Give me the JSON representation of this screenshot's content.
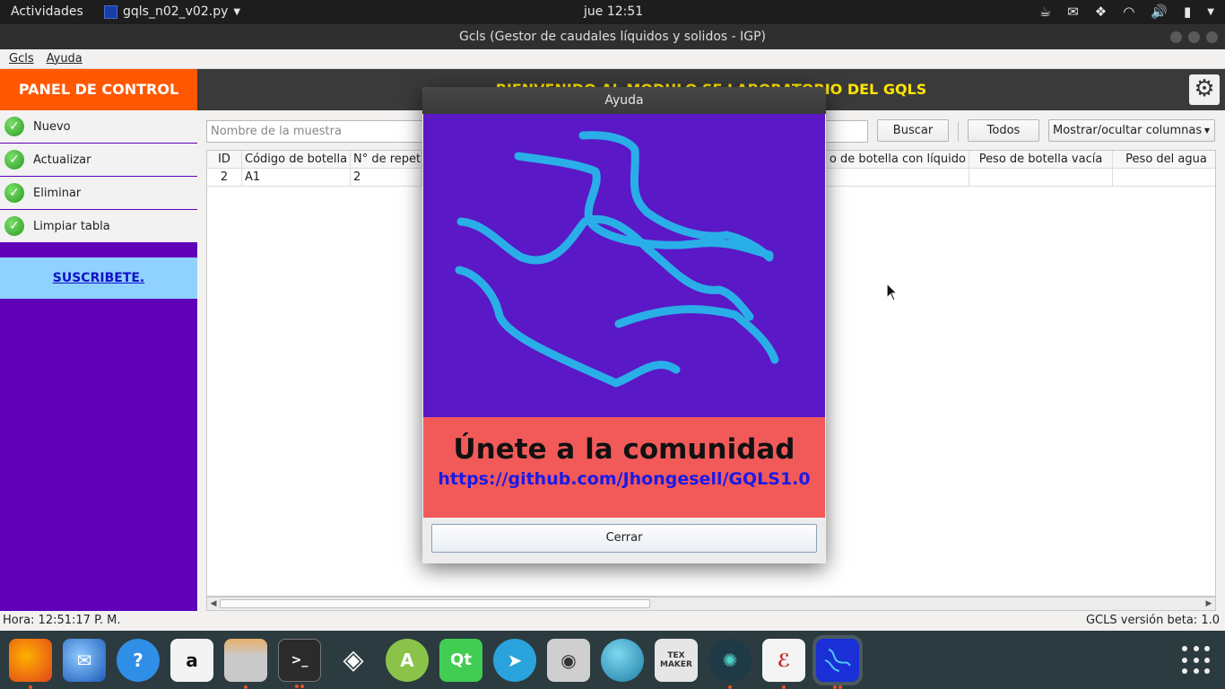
{
  "topbar": {
    "activities": "Actividades",
    "app_name": "gqls_n02_v02.py",
    "clock": "jue 12:51"
  },
  "window": {
    "title": "Gcls (Gestor de caudales líquidos y solidos - IGP)"
  },
  "menubar": {
    "items": [
      {
        "label": "Gcls"
      },
      {
        "label": "Ayuda"
      }
    ]
  },
  "sidebar": {
    "header": "PANEL DE CONTROL",
    "items": [
      {
        "label": "Nuevo"
      },
      {
        "label": "Actualizar"
      },
      {
        "label": "Eliminar"
      },
      {
        "label": "Limpiar tabla"
      }
    ],
    "subscribe": "SUSCRIBETE."
  },
  "main": {
    "banner": "BIENVENIDO AL MODULO SE LABORATORIO DEL GQLS",
    "search_placeholder": "Nombre de la muestra",
    "search_button": "Buscar",
    "all_button": "Todos",
    "columns_button": "Mostrar/ocultar columnas"
  },
  "table": {
    "headers": [
      "ID",
      "Código de botella",
      "N° de repet",
      "",
      "o de botella con líquido",
      "Peso de botella vacía",
      "Peso del agua"
    ],
    "rows": [
      [
        "2",
        "A1",
        "2",
        "",
        "",
        "",
        ""
      ]
    ]
  },
  "status": {
    "left": "Hora: 12:51:17 P. M.",
    "right": "GCLS versión beta: 1.0"
  },
  "dialog": {
    "title": "Ayuda",
    "headline": "Únete a la comunidad",
    "url": "https://github.com/Jhongesell/GQLS1.0",
    "close_button": "Cerrar"
  },
  "dock": {
    "apps": [
      {
        "icon": "firefox-icon"
      },
      {
        "icon": "thunderbird-icon"
      },
      {
        "icon": "help-icon"
      },
      {
        "icon": "amazon-icon"
      },
      {
        "icon": "files-icon"
      },
      {
        "icon": "terminal-icon"
      },
      {
        "icon": "unity-icon"
      },
      {
        "icon": "android-studio-icon"
      },
      {
        "icon": "qt-creator-icon"
      },
      {
        "icon": "telegram-icon"
      },
      {
        "icon": "camera-icon"
      },
      {
        "icon": "globe-icon"
      },
      {
        "icon": "texmaker-icon"
      },
      {
        "icon": "gitkraken-icon"
      },
      {
        "icon": "pdf-viewer-icon"
      },
      {
        "icon": "gcls-app-icon"
      }
    ],
    "dock_labels": {
      "help": "?",
      "qt": "Qt",
      "tex": "TEX MAKER",
      "terminal": ">_"
    }
  },
  "colors": {
    "sidebar_bg": "#6000b8",
    "panel_header": "#ff5800",
    "banner_text": "#ffe600",
    "subscribe_bg": "#8fd1ff",
    "dialog_art": "#5a18c6",
    "dialog_cta": "#f25a5a",
    "link": "#1a1ae6"
  }
}
